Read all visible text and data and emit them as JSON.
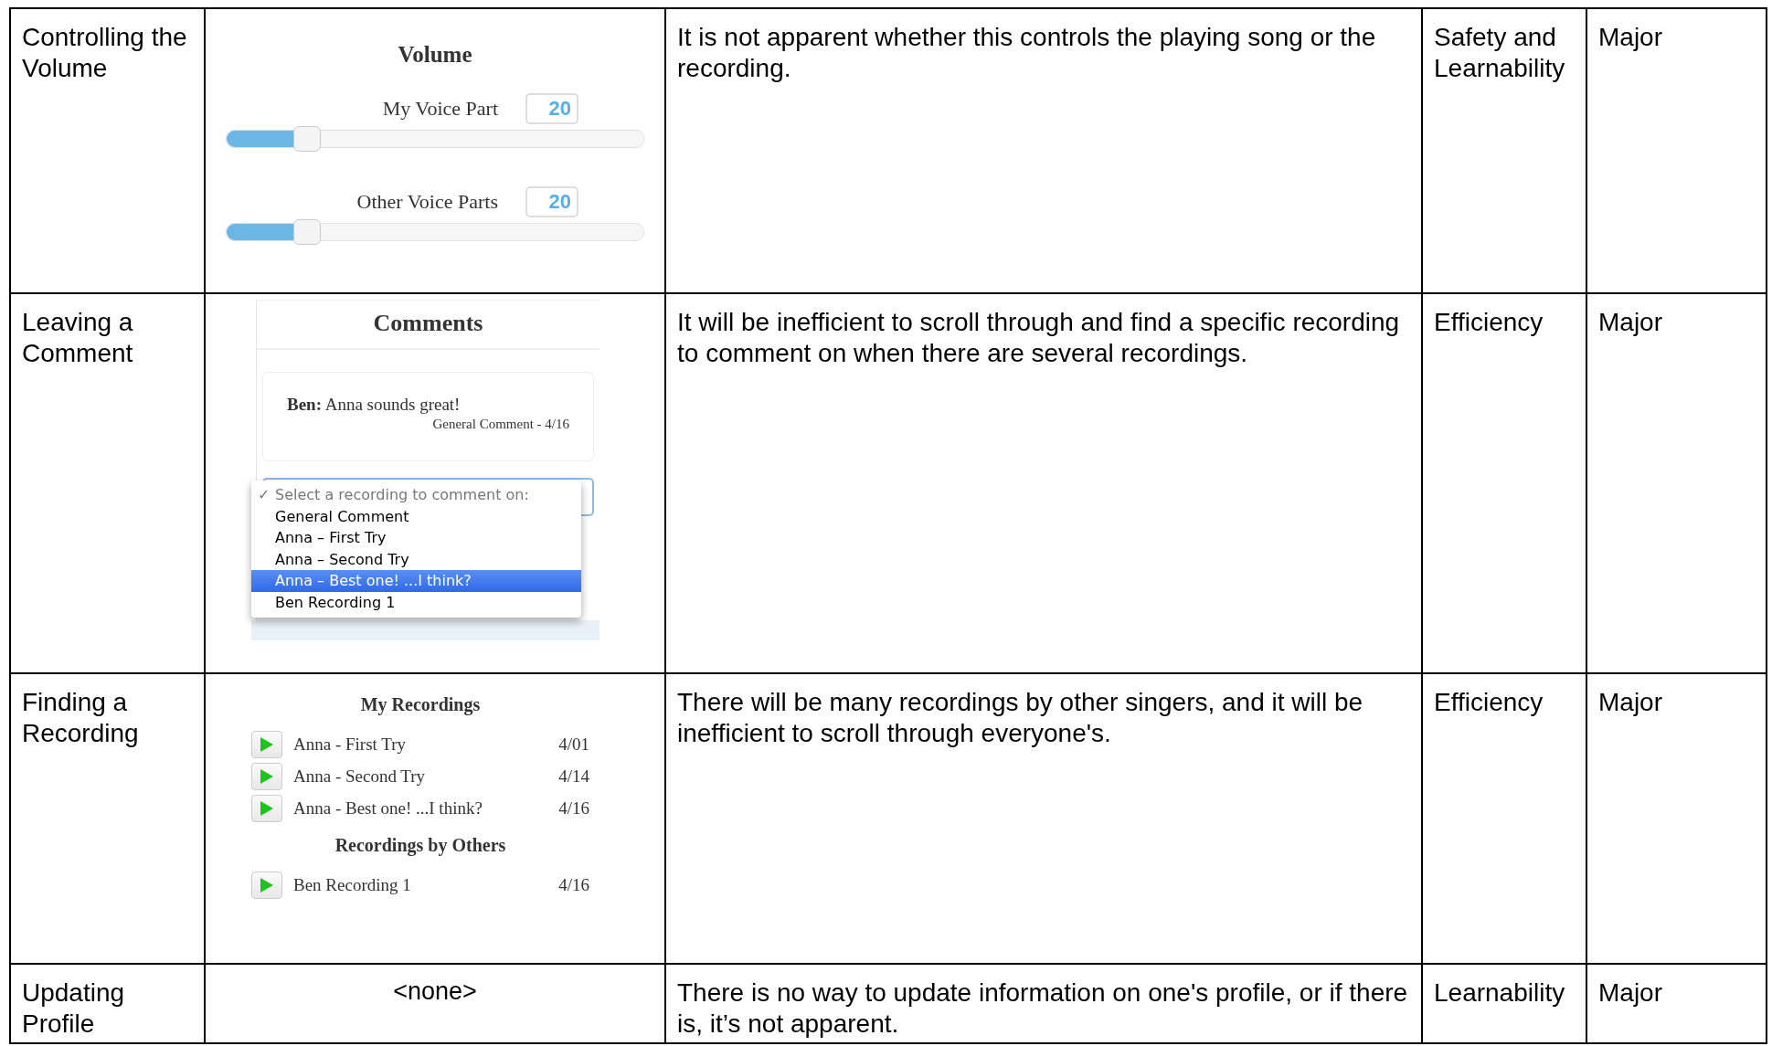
{
  "rows": [
    {
      "task": "Controlling the Volume",
      "problem": "It is not apparent whether this controls the playing song or the recording.",
      "category": "Safety and Learnability",
      "severity": "Major",
      "example": {
        "kind": "volume",
        "title": "Volume",
        "sliders": [
          {
            "label": "My Voice Part",
            "value": "20",
            "level": 0.19
          },
          {
            "label": "Other Voice Parts",
            "value": "20",
            "level": 0.19
          }
        ]
      }
    },
    {
      "task": "Leaving a Comment",
      "problem": "It will be inefficient to scroll through and find a specific recording to comment on when there are several recordings.",
      "category": "Efficiency",
      "severity": "Major",
      "example": {
        "kind": "comments",
        "title": "Comments",
        "comment": {
          "author": "Ben:",
          "text": "Anna sounds great!",
          "meta": "General Comment - 4/16"
        },
        "check_mark": "✓",
        "menu": [
          {
            "label": "Select a recording to comment on:",
            "checked": true,
            "selected": false
          },
          {
            "label": "General Comment",
            "checked": false,
            "selected": false
          },
          {
            "label": "Anna – First Try",
            "checked": false,
            "selected": false
          },
          {
            "label": "Anna – Second Try",
            "checked": false,
            "selected": false
          },
          {
            "label": "Anna – Best one! ...I think?",
            "checked": false,
            "selected": true
          },
          {
            "label": "Ben Recording 1",
            "checked": false,
            "selected": false
          }
        ]
      }
    },
    {
      "task": "Finding a Recording",
      "problem": "There will be many recordings by other singers, and it will be inefficient to scroll through everyone's.",
      "category": "Efficiency",
      "severity": "Major",
      "example": {
        "kind": "recordings",
        "sections": [
          {
            "title": "My Recordings",
            "items": [
              {
                "name": "Anna - First Try",
                "date": "4/01"
              },
              {
                "name": "Anna - Second Try",
                "date": "4/14"
              },
              {
                "name": "Anna - Best one! ...I think?",
                "date": "4/16"
              }
            ]
          },
          {
            "title": "Recordings by Others",
            "items": [
              {
                "name": "Ben Recording 1",
                "date": "4/16"
              }
            ]
          }
        ]
      }
    },
    {
      "task": "Updating Profile",
      "problem": "There is no way to update information on one's profile, or if there is, it’s not apparent.",
      "category": "Learnability",
      "severity": "Major",
      "example": {
        "kind": "none",
        "text": "<none>"
      }
    }
  ]
}
